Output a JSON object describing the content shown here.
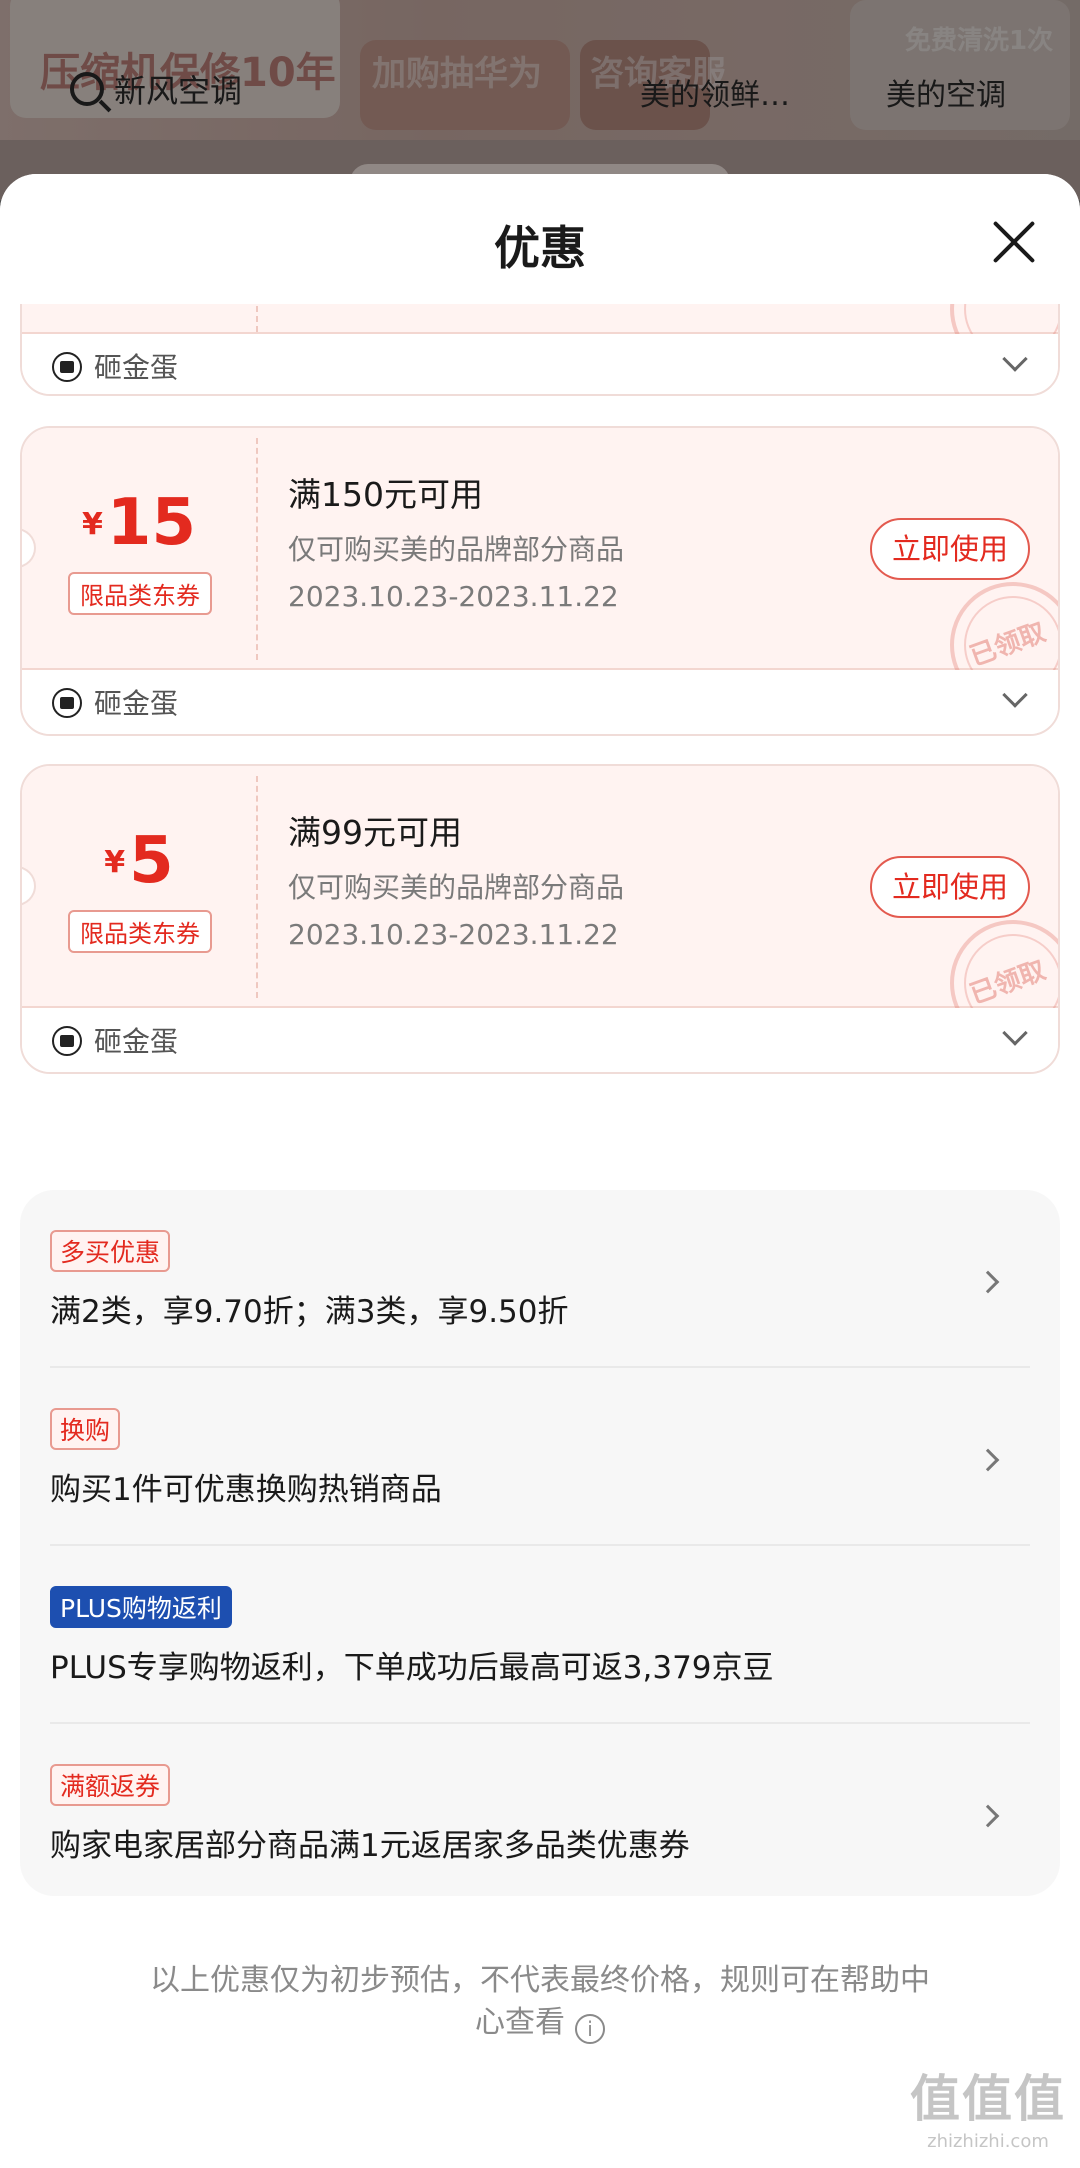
{
  "background": {
    "banner_text_1": "压缩机保修10年",
    "banner_text_2": "加购抽华为",
    "banner_text_3": "咨询客服",
    "banner_text_4": "免费清洗1次",
    "search_text": "新风空调",
    "chip_1": "美的领鲜…",
    "chip_2": "美的空调"
  },
  "sheet": {
    "title": "优惠",
    "close_icon": "close-icon"
  },
  "partial_coupon": {
    "foot_label": "砸金蛋"
  },
  "coupons": [
    {
      "currency": "¥",
      "amount": "15",
      "tag": "限品类东券",
      "title": "满150元可用",
      "desc": "仅可购买美的品牌部分商品",
      "date": "2023.10.23-2023.11.22",
      "button": "立即使用",
      "stamp": "已领取",
      "foot_label": "砸金蛋"
    },
    {
      "currency": "¥",
      "amount": "5",
      "tag": "限品类东券",
      "title": "满99元可用",
      "desc": "仅可购买美的品牌部分商品",
      "date": "2023.10.23-2023.11.22",
      "button": "立即使用",
      "stamp": "已领取",
      "foot_label": "砸金蛋"
    }
  ],
  "promotions": [
    {
      "tag": "多买优惠",
      "text": "满2类，享9.70折；满3类，享9.50折"
    },
    {
      "tag": "换购",
      "text": "购买1件可优惠换购热销商品"
    },
    {
      "tag": "PLUS购物返利",
      "text": "PLUS专享购物返利，下单成功后最高可返3,379京豆"
    },
    {
      "tag": "满额返券",
      "text": "购家电家居部分商品满1元返居家多品类优惠券"
    }
  ],
  "disclaimer": {
    "line1": "以上优惠仅为初步预估，不代表最终价格，规则可在帮助中",
    "line2": "心查看",
    "icon": "info-icon"
  },
  "watermark": {
    "big": "值值值",
    "small": "zhizhizhi.com"
  },
  "colors": {
    "accent_red": "#e32a1f",
    "plus_blue": "#1d4fb0",
    "coupon_bg": "#fff3f1"
  }
}
